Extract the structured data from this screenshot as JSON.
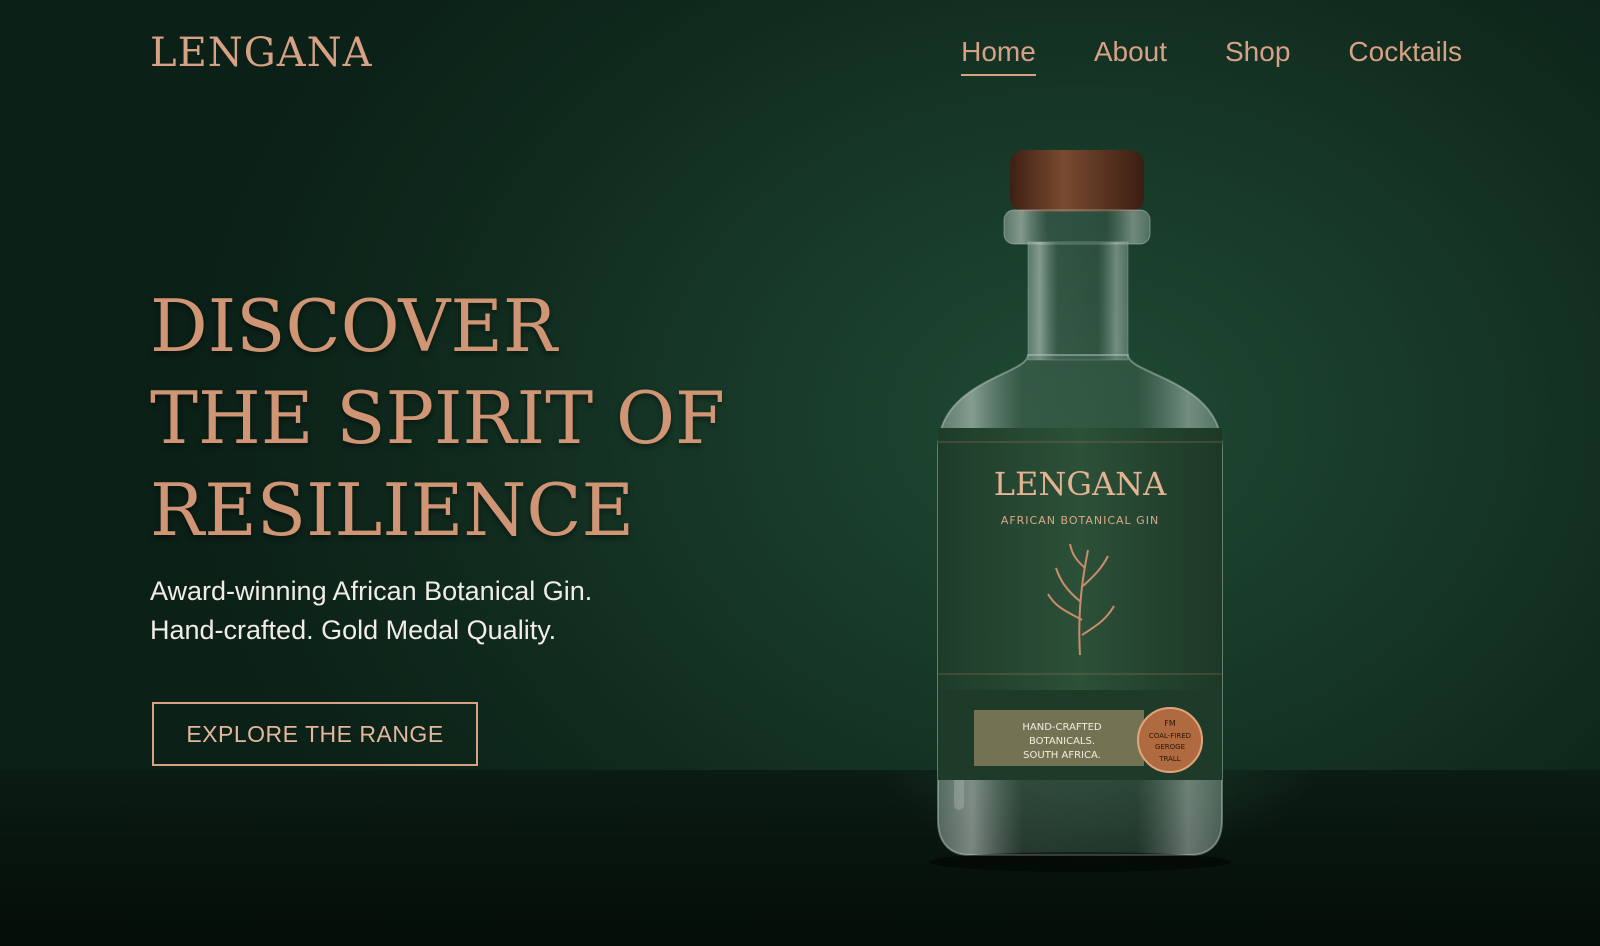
{
  "brand": {
    "logo": "LENGANA"
  },
  "nav": {
    "items": [
      {
        "label": "Home"
      },
      {
        "label": "About"
      },
      {
        "label": "Shop"
      },
      {
        "label": "Cocktails"
      }
    ],
    "active": "Home"
  },
  "hero": {
    "title_lines": [
      "DISCOVER",
      "THE SPIRIT OF",
      "RESILIENCE"
    ],
    "subtitle_lines": [
      "Award-winning African Botanical Gin.",
      "Hand-crafted. Gold Medal Quality."
    ],
    "cta_label": "EXPLORE THE RANGE"
  },
  "product": {
    "label_brand": "LENGANA",
    "label_tagline": "AFRICAN BOTANICAL GIN",
    "lower_label_lines": [
      "HAND-CRAFTED",
      "BOTANICALS.",
      "SOUTH AFRICA."
    ],
    "seal_lines": [
      "FM",
      "COAL-FIRED",
      "GEROGE",
      "TRALL"
    ]
  },
  "colors": {
    "background": "#163626",
    "accent_copper": "#d6a184",
    "label_green": "#2c5038",
    "text_light": "#f1ece6"
  }
}
